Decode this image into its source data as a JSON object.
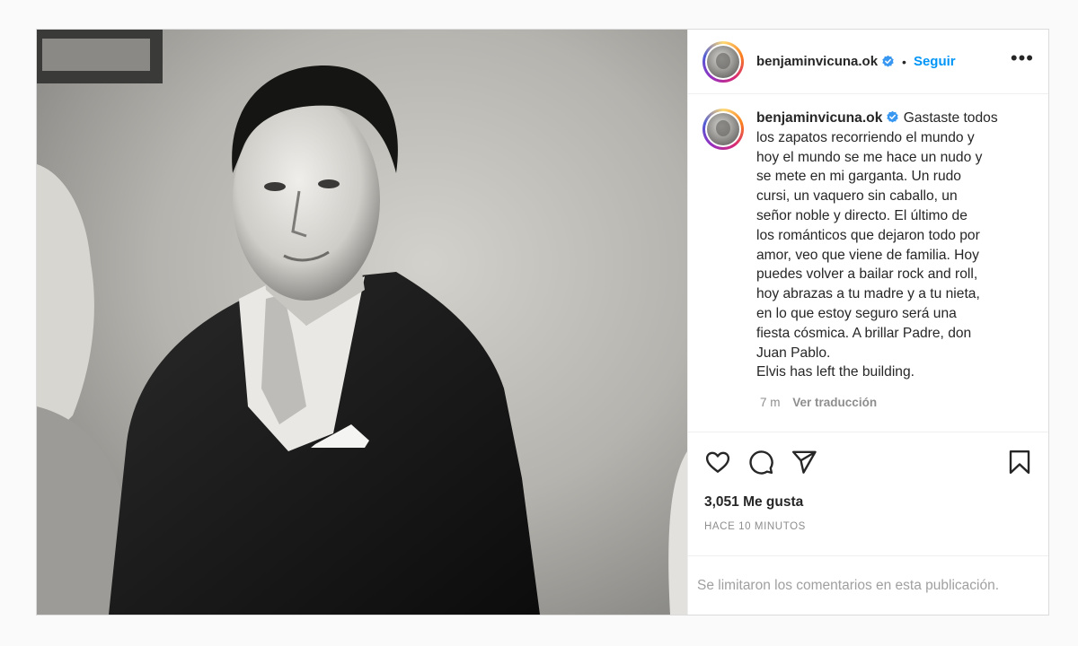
{
  "post": {
    "username": "benjaminvicuna.ok",
    "follow_label": "Seguir",
    "separator": "•",
    "more_label": "•••",
    "caption": "Gastaste todos\nlos zapatos recorriendo el mundo y\nhoy el mundo se me hace un nudo y\nse mete en mi garganta. Un rudo\ncursi, un vaquero sin caballo, un\nseñor noble y directo. El último de\nlos románticos que dejaron todo por\namor, veo que viene de familia. Hoy\npuedes volver a bailar rock and roll,\nhoy abrazas a tu madre y a tu nieta,\nen lo que estoy seguro será una\nfiesta cósmica. A brillar Padre, don\nJuan Pablo.\nElvis has left the building.",
    "time_ago": "7 m",
    "translate_label": "Ver traducción",
    "likes": "3,051 Me gusta",
    "posted_time": "HACE 10 MINUTOS",
    "comments_limited": "Se limitaron los comentarios en esta publicación."
  },
  "icons": {
    "like": "heart-icon",
    "comment": "comment-icon",
    "share": "send-icon",
    "save": "bookmark-icon",
    "verified": "verified-badge-icon"
  },
  "colors": {
    "accent": "#0095f6",
    "text": "#262626",
    "muted": "#8e8e8e",
    "border": "#dbdbdb"
  }
}
